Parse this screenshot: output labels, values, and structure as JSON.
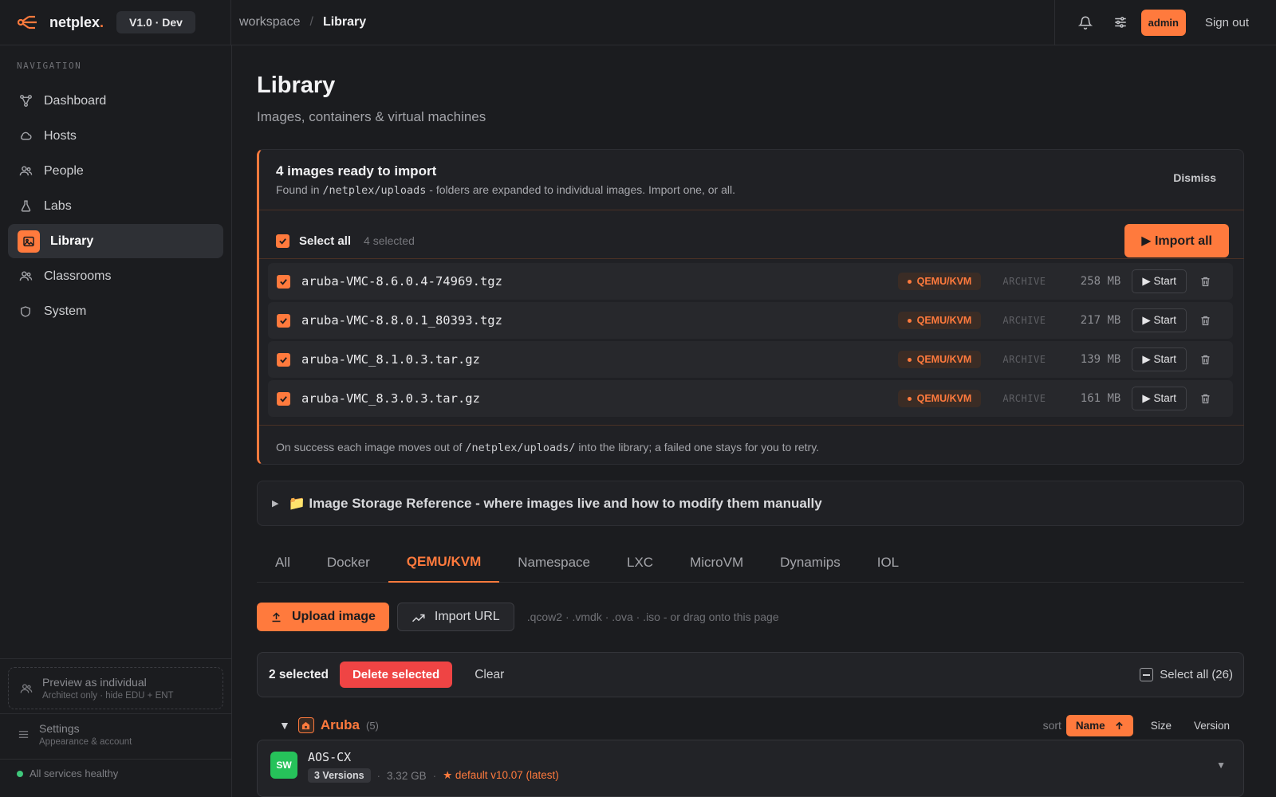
{
  "app": {
    "brand_name": "netplex",
    "brand_dot": ".",
    "version": "V1.0 · Dev",
    "accent_color": "#ff7a3d"
  },
  "breadcrumb": {
    "parent": "workspace",
    "separator": "/",
    "current": "Library"
  },
  "topbar": {
    "bell_icon": "bell-icon",
    "settings_icon": "sliders-icon",
    "role_badge": "admin",
    "sign_out": "Sign out"
  },
  "sidebar": {
    "title": "NAVIGATION",
    "items": [
      {
        "label": "Dashboard",
        "icon": "graph-icon"
      },
      {
        "label": "Hosts",
        "icon": "cloud-icon"
      },
      {
        "label": "People",
        "icon": "people-icon"
      },
      {
        "label": "Labs",
        "icon": "flask-icon"
      },
      {
        "label": "Library",
        "icon": "image-icon"
      },
      {
        "label": "Classrooms",
        "icon": "people-icon"
      },
      {
        "label": "System",
        "icon": "shield-icon"
      }
    ],
    "active_item": "Library",
    "preview": {
      "title": "Preview as individual",
      "desc": "Architect only · hide EDU + ENT"
    },
    "settings": {
      "title": "Settings",
      "desc": "Appearance & account"
    },
    "health": "All services healthy"
  },
  "page": {
    "title": "Library",
    "subtitle": "Images, containers & virtual machines"
  },
  "import_panel": {
    "title": "4 images ready to import",
    "desc_prefix": "Found in ",
    "desc_path": "/netplex/uploads",
    "desc_suffix": " - folders are expanded to individual images. Import one, or all.",
    "dismiss": "Dismiss",
    "select_all": "Select all",
    "selected_count": "4 selected",
    "import_all": "▶ Import all",
    "files": [
      {
        "name": "aruba-VMC-8.6.0.4-74969.tgz",
        "type": "QEMU/KVM",
        "kind": "ARCHIVE",
        "size": "258 MB",
        "action": "▶ Start",
        "checked": true
      },
      {
        "name": "aruba-VMC-8.8.0.1_80393.tgz",
        "type": "QEMU/KVM",
        "kind": "ARCHIVE",
        "size": "217 MB",
        "action": "▶ Start",
        "checked": true
      },
      {
        "name": "aruba-VMC_8.1.0.3.tar.gz",
        "type": "QEMU/KVM",
        "kind": "ARCHIVE",
        "size": "139 MB",
        "action": "▶ Start",
        "checked": true
      },
      {
        "name": "aruba-VMC_8.3.0.3.tar.gz",
        "type": "QEMU/KVM",
        "kind": "ARCHIVE",
        "size": "161 MB",
        "action": "▶ Start",
        "checked": true
      }
    ],
    "footer_prefix": "On success each image moves out of ",
    "footer_path": "/netplex/uploads/",
    "footer_suffix": " into the library; a failed one stays for you to retry."
  },
  "storage_ref": {
    "label": "📁 Image Storage Reference - where images live and how to modify them manually"
  },
  "tabs": {
    "items": [
      "All",
      "Docker",
      "QEMU/KVM",
      "Namespace",
      "LXC",
      "MicroVM",
      "Dynamips",
      "IOL"
    ],
    "active": "QEMU/KVM"
  },
  "actions": {
    "upload": "Upload image",
    "import_url": "Import URL",
    "formats": ".qcow2 · .vmdk · .ova · .iso - or drag onto this page"
  },
  "selection": {
    "count": "2 selected",
    "delete": "Delete selected",
    "clear": "Clear",
    "select_all": "Select all (26)"
  },
  "group": {
    "name": "Aruba",
    "count": "(5)",
    "sort_label": "sort",
    "sort_active": "Name",
    "sort_size": "Size",
    "sort_version": "Version"
  },
  "image": {
    "badge": "SW",
    "name": "AOS-CX",
    "versions": "3 Versions",
    "dot": "·",
    "size": "3.32 GB",
    "default": "★ default v10.07 (latest)"
  }
}
